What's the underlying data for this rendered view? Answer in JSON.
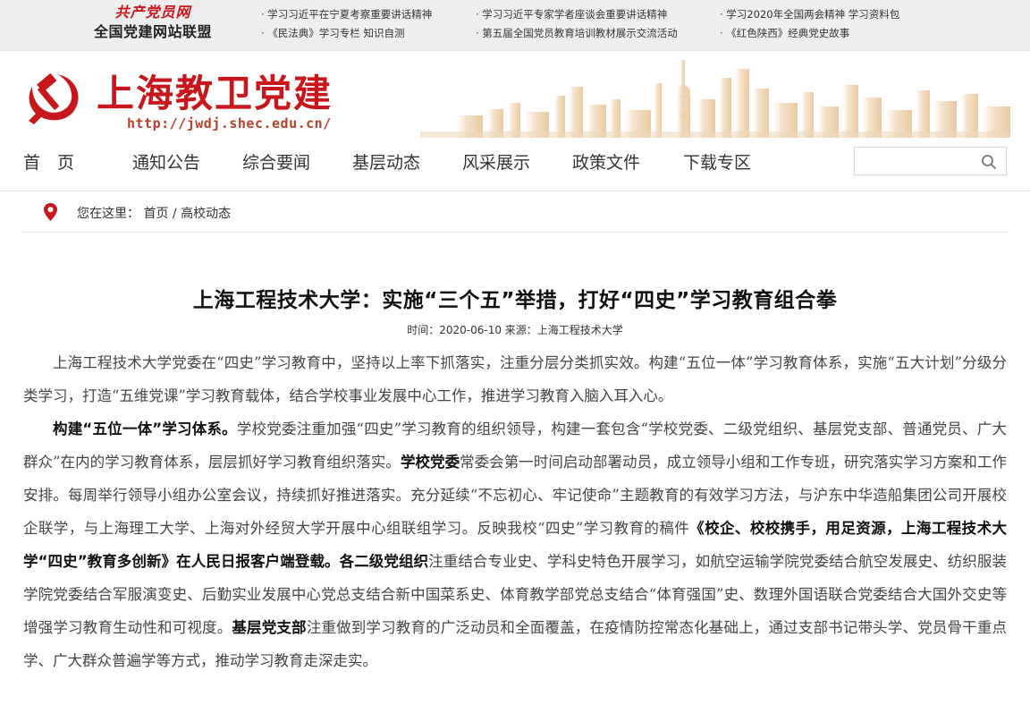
{
  "alliance": {
    "logo_text": "共产党员网",
    "name": "全国党建网站联盟"
  },
  "top_links": [
    "· 学习习近平在宁夏考察重要讲话精神",
    "· 学习习近平专家学者座谈会重要讲话精神",
    "· 学习2020年全国两会精神 学习资料包",
    "· 《民法典》学习专栏 知识自测",
    "· 第五届全国党员教育培训教材展示交流活动",
    "· 《红色陕西》经典党史故事"
  ],
  "header": {
    "site_title": "上海教卫党建",
    "site_url": "http://jwdj.shec.edu.cn/"
  },
  "nav": [
    "首　页",
    "通知公告",
    "综合要闻",
    "基层动态",
    "风采展示",
    "政策文件",
    "下载专区"
  ],
  "search": {
    "placeholder": ""
  },
  "breadcrumb": {
    "prefix": "您在这里：",
    "home": "首页",
    "sep": " / ",
    "current": "高校动态"
  },
  "article": {
    "title": "上海工程技术大学：实施“三个五”举措，打好“四史”学习教育组合拳",
    "meta": "时间：2020-06-10 来源：上海工程技术大学",
    "p1": "上海工程技术大学党委在“四史”学习教育中，坚持以上率下抓落实，注重分层分类抓实效。构建“五位一体”学习教育体系，实施“五大计划”分级分类学习，打造“五维党课”学习教育载体，结合学校事业发展中心工作，推进学习教育入脑入耳入心。",
    "p2_b1": "构建“五位一体”学习体系。",
    "p2_t1": "学校党委注重加强“四史”学习教育的组织领导，构建一套包含“学校党委、二级党组织、基层党支部、普通党员、广大群众”在内的学习教育体系，层层抓好学习教育组织落实。",
    "p2_b2": "学校党委",
    "p2_t2": "常委会第一时间启动部署动员，成立领导小组和工作专班，研究落实学习方案和工作安排。每周举行领导小组办公室会议，持续抓好推进落实。充分延续“不忘初心、牢记使命”主题教育的有效学习方法，与沪东中华造船集团公司开展校企联学，与上海理工大学、上海对外经贸大学开展中心组联组学习。反映我校“四史”学习教育的稿件",
    "p2_b3": "《校企、校校携手，用足资源，上海工程技术大学“四史”教育多创新》在人民日报客户端登载。",
    "p2_b4": "各二级党组织",
    "p2_t3": "注重结合专业史、学科史特色开展学习，如航空运输学院党委结合航空发展史、纺织服装学院党委结合军服演变史、后勤实业发展中心党总支结合新中国菜系史、体育教学部党总支结合“体育强国”史、数理外国语联合党委结合大国外交史等增强学习教育生动性和可视度。",
    "p2_b5": "基层党支部",
    "p2_t4": "注重做到学习教育的广泛动员和全面覆盖，在疫情防控常态化基础上，通过支部书记带头学、党员骨干重点学、广大群众普遍学等方式，推动学习教育走深走实。"
  },
  "colors": {
    "brand_red": "#c8161d",
    "topbar_bg": "#eeeeee"
  }
}
